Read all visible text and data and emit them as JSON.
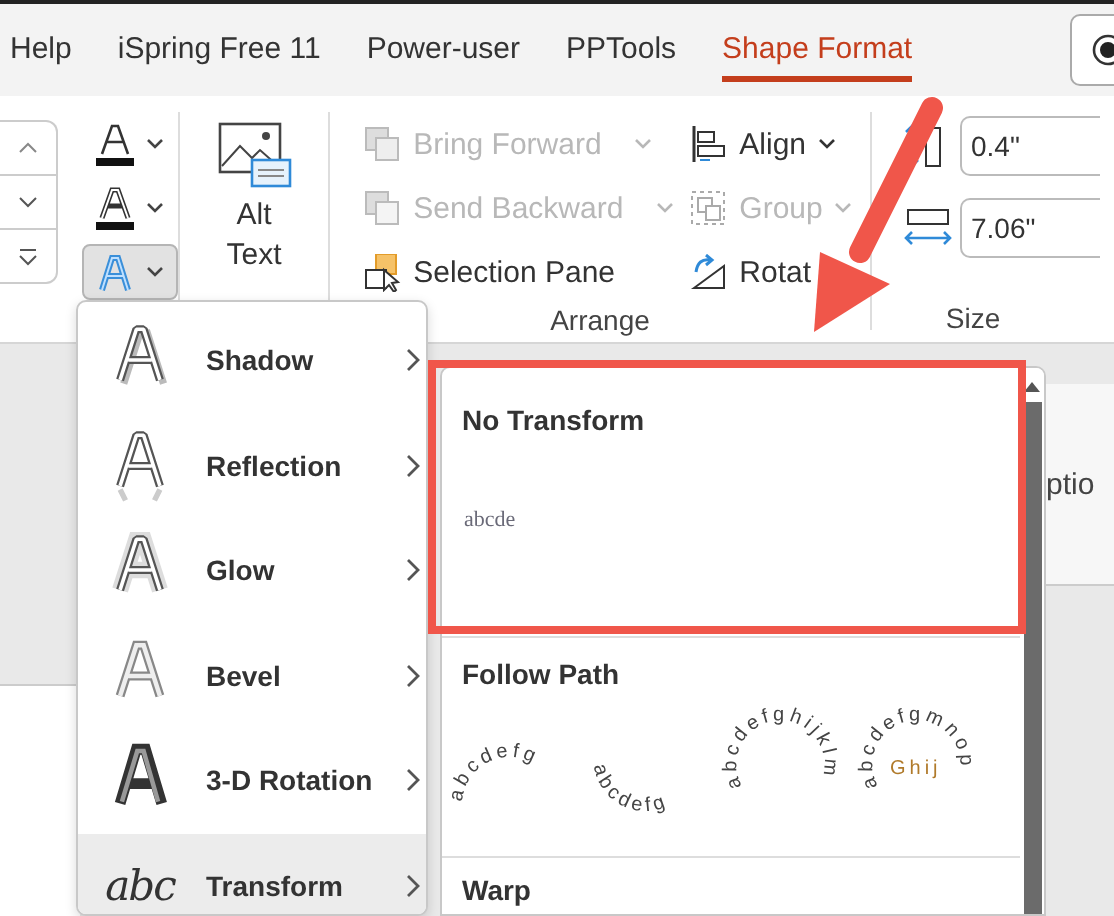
{
  "ribbon_tabs": [
    {
      "label": "Help",
      "selected": false
    },
    {
      "label": "iSpring Free 11",
      "selected": false
    },
    {
      "label": "Power-user",
      "selected": false
    },
    {
      "label": "PPTools",
      "selected": false
    },
    {
      "label": "Shape Format",
      "selected": true
    }
  ],
  "wordart_buttons": [
    {
      "kind": "fill",
      "selected": false
    },
    {
      "kind": "outline",
      "selected": false
    },
    {
      "kind": "effects",
      "selected": true
    }
  ],
  "alt_text": {
    "label": "Alt Text"
  },
  "arrange": {
    "label": "Arrange",
    "buttons": [
      {
        "kind": "bring-forward",
        "label": "Bring Forward",
        "disabled": true,
        "dropdown": true
      },
      {
        "kind": "send-backward",
        "label": "Send Backward",
        "disabled": true,
        "dropdown": true
      },
      {
        "kind": "selection-pane",
        "label": "Selection Pane",
        "disabled": false,
        "dropdown": false
      },
      {
        "kind": "align",
        "label": "Align",
        "disabled": false,
        "dropdown": true
      },
      {
        "kind": "group",
        "label": "Group",
        "disabled": true,
        "dropdown": true
      },
      {
        "kind": "rotate",
        "label": "Rotat",
        "disabled": false,
        "dropdown": false
      }
    ]
  },
  "size": {
    "label": "Size",
    "height": "0.4\"",
    "width": "7.06\""
  },
  "side_panel": {
    "text": "ptio"
  },
  "effects_menu": {
    "items": [
      {
        "kind": "shadow",
        "label": "Shadow",
        "selected": false
      },
      {
        "kind": "reflection",
        "label": "Reflection",
        "selected": false
      },
      {
        "kind": "glow",
        "label": "Glow",
        "selected": false
      },
      {
        "kind": "bevel",
        "label": "Bevel",
        "selected": false
      },
      {
        "kind": "rotation",
        "label": "3-D Rotation",
        "selected": false
      },
      {
        "kind": "transform",
        "label": "Transform",
        "selected": true,
        "icon_text": "abc"
      }
    ]
  },
  "transform_gallery": {
    "sections": [
      {
        "title": "No Transform",
        "samples": [
          {
            "kind": "plain",
            "text": "abcde"
          }
        ]
      },
      {
        "title": "Follow Path",
        "samples": [
          {
            "kind": "arch-up",
            "text": "abcdefg"
          },
          {
            "kind": "arch-down",
            "text": "abcdefg"
          },
          {
            "kind": "circle",
            "text": "abcdefghijklm"
          },
          {
            "kind": "button",
            "text": "abcdefgmnop",
            "inner": "Ghij"
          }
        ]
      },
      {
        "title": "Warp"
      }
    ]
  }
}
